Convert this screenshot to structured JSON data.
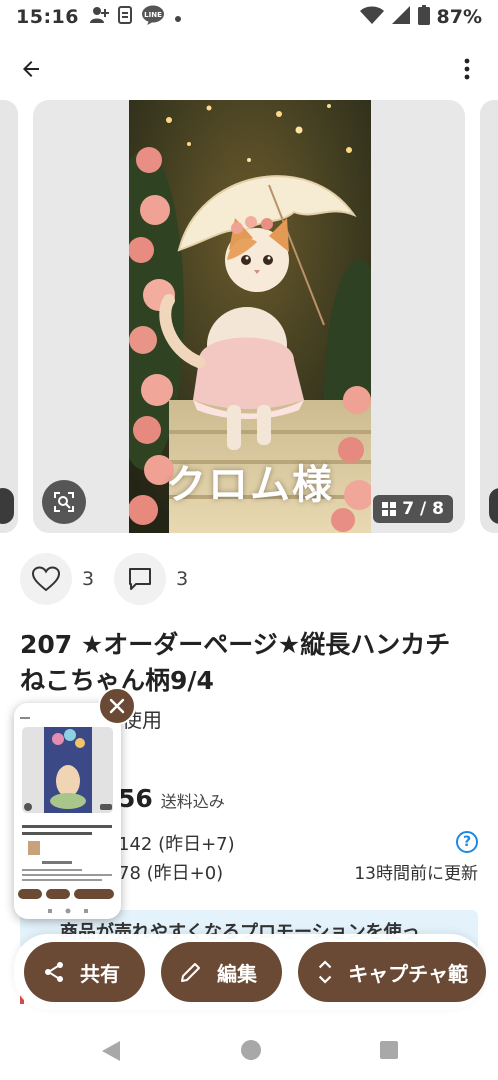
{
  "status_bar": {
    "time": "15:16",
    "battery": "87%",
    "icons": [
      "person-add-icon",
      "sim-icon",
      "line-icon",
      "dot-icon",
      "wifi-icon",
      "signal-icon",
      "battery-icon"
    ]
  },
  "app_bar": {
    "back_icon": "arrow-left-icon",
    "more_icon": "more-vert-icon"
  },
  "carousel": {
    "watermark": "クロム様",
    "counter": "7 / 8",
    "lens_icon": "lens-icon"
  },
  "reactions": {
    "likes": "3",
    "comments": "3"
  },
  "product": {
    "title": "207 ★オーダーページ★縦長ハンカチ　ねこちゃん柄9/4",
    "subtext": "使用",
    "price": "56",
    "price_note": "送料込み",
    "stat1": "142 (昨日+7)",
    "stat2": "78 (昨日+0)",
    "updated": "13時間前に更新",
    "help_glyph": "?"
  },
  "promo": {
    "text": "商品が売れやすくなるプロモーションを使っ"
  },
  "actions": {
    "share": "共有",
    "edit": "編集",
    "capture": "キャプチャ範"
  },
  "colors": {
    "accent_brown": "#6a4a35",
    "promo_bg": "#e3f2fb",
    "help_blue": "#1e88e5"
  }
}
